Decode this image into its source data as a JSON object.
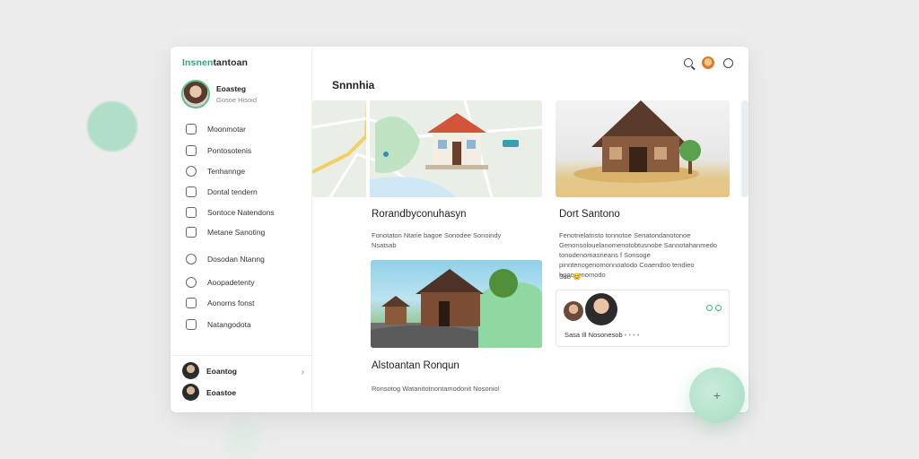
{
  "app": {
    "brand_left": "Insnen",
    "brand_right": "tantoan"
  },
  "profile": {
    "name": "Eoasteg",
    "sub": "Gosoe Hisoid"
  },
  "sidebar": {
    "items": [
      {
        "label": "Moonmotar",
        "icon": "heart-icon"
      },
      {
        "label": "Pontosotenis",
        "icon": "home-icon"
      },
      {
        "label": "Tenhannge",
        "icon": "compass-icon"
      },
      {
        "label": "Dontal tendern",
        "icon": "folder-icon"
      },
      {
        "label": "Sontoce Natendons",
        "icon": "grid-icon"
      },
      {
        "label": "Metane Sanoting",
        "icon": "pencil-icon"
      },
      {
        "label": "Dosodan Ntanng",
        "icon": "clock-icon"
      },
      {
        "label": "Aoopadetenty",
        "icon": "chat-icon"
      },
      {
        "label": "Aonorns fonst",
        "icon": "book-icon"
      },
      {
        "label": "Natangodota",
        "icon": "edit-icon"
      }
    ],
    "users": [
      {
        "name": "Eoantog"
      },
      {
        "name": "Eoastoe"
      }
    ]
  },
  "main": {
    "page_title": "Snnnhia",
    "cards": [
      {
        "title": "Rorandbyconuhasyn",
        "text": "Fonotaton Ntarie bagoe Sonodee Sonoindy Nsatsab"
      },
      {
        "title": "Dort Santono",
        "text": "Fenotnelatnsto tonnotoe Senatondanotonoe Genonsolouelanomenotobtusnobe Sannotahanmedo tonodenomasneans f Sonsoge pinntenogenomonnoatodo Coaendoo tendieo hgoosenomodo"
      },
      {
        "title": "Alstoantan Ronqun",
        "text": "Ronsotog Watanitotnontamodonit Nosonio!"
      }
    ],
    "mini_card": {
      "caption": "Sasa Ill Nosonesob",
      "caption_muted": "• • • •",
      "extra": "Sso 😊"
    }
  },
  "colors": {
    "accent": "#2aa77a",
    "mint": "#a6dcc2"
  }
}
